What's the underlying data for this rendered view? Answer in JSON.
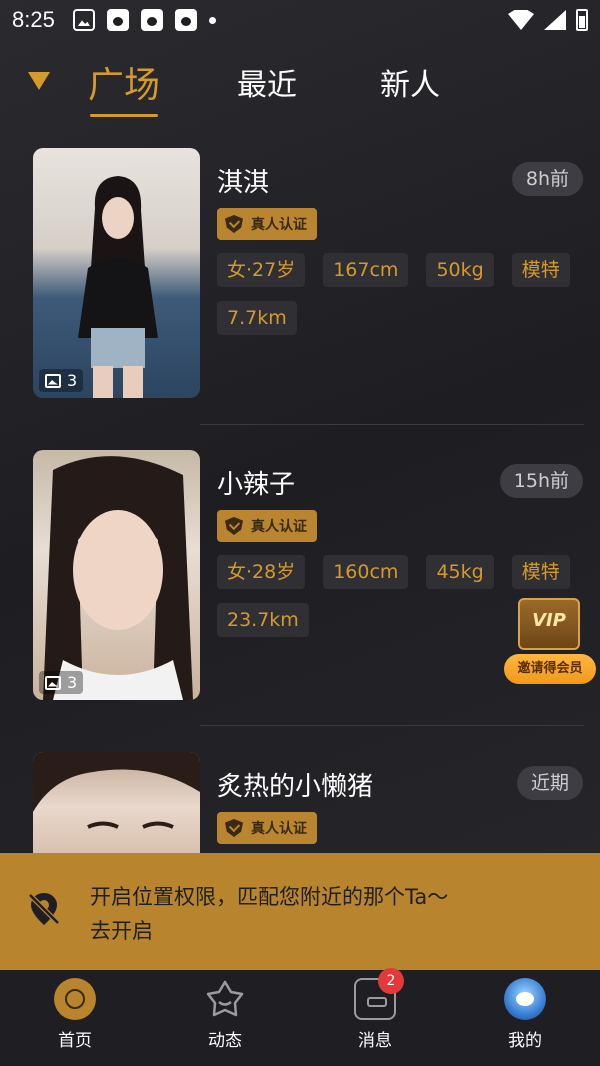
{
  "status_bar": {
    "time": "8:25"
  },
  "tabs": [
    {
      "label": "广场",
      "active": true
    },
    {
      "label": "最近",
      "active": false
    },
    {
      "label": "新人",
      "active": false
    }
  ],
  "verified_label": "真人认证",
  "cards": [
    {
      "name": "淇淇",
      "time": "8h前",
      "photo_count": "3",
      "tags": [
        "女·27岁",
        "167cm",
        "50kg",
        "模特",
        "7.7km"
      ]
    },
    {
      "name": "小辣子",
      "time": "15h前",
      "photo_count": "3",
      "tags": [
        "女·28岁",
        "160cm",
        "45kg",
        "模特",
        "23.7km"
      ]
    },
    {
      "name": "炙热的小懒猪",
      "time": "近期"
    }
  ],
  "vip": {
    "badge": "VIP",
    "label": "邀请得会员"
  },
  "location_banner": {
    "line1": "开启位置权限，匹配您附近的那个Ta～",
    "line2": "去开启"
  },
  "bottom_nav": {
    "items": [
      {
        "label": "首页",
        "icon": "home-icon"
      },
      {
        "label": "动态",
        "icon": "moments-icon"
      },
      {
        "label": "消息",
        "icon": "message-icon",
        "badge": "2"
      },
      {
        "label": "我的",
        "icon": "avatar-icon"
      }
    ]
  },
  "colors": {
    "accent": "#d39a2e",
    "banner": "#b8842e",
    "background": "#1f1f23",
    "badge": "#e23a3a"
  }
}
